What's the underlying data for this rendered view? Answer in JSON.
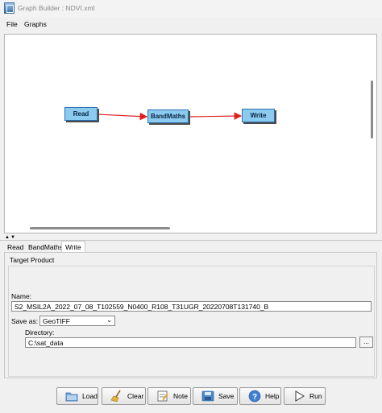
{
  "window": {
    "title": "Graph Builder : NDVI.xml"
  },
  "menu": [
    "File",
    "Graphs"
  ],
  "graph": {
    "nodes": [
      {
        "id": "read",
        "label": "Read"
      },
      {
        "id": "bandmaths",
        "label": "BandMaths"
      },
      {
        "id": "write",
        "label": "Write"
      }
    ],
    "edges": [
      {
        "from": "Read",
        "to": "BandMaths"
      },
      {
        "from": "BandMaths",
        "to": "Write"
      }
    ],
    "edge_color": "#e02020",
    "node_fill": "#8ccbf0"
  },
  "tabs": [
    {
      "label": "Read",
      "active": false
    },
    {
      "label": "BandMaths",
      "active": false
    },
    {
      "label": "Write",
      "active": true
    }
  ],
  "write_panel": {
    "section_title": "Target Product",
    "name_label": "Name:",
    "name_value": "S2_MSIL2A_2022_07_08_T102559_N0400_R108_T31UGR_20220708T131740_B",
    "save_as_label": "Save as:",
    "save_as_value": "GeoTIFF",
    "directory_label": "Directory:",
    "directory_value": "C:\\sat_data",
    "browse_label": "..."
  },
  "buttons": [
    {
      "label": "Load",
      "icon": "folder-icon"
    },
    {
      "label": "Clear",
      "icon": "broom-icon"
    },
    {
      "label": "Note",
      "icon": "note-icon"
    },
    {
      "label": "Save",
      "icon": "disk-icon"
    },
    {
      "label": "Help",
      "icon": "help-icon"
    },
    {
      "label": "Run",
      "icon": "play-icon"
    }
  ]
}
